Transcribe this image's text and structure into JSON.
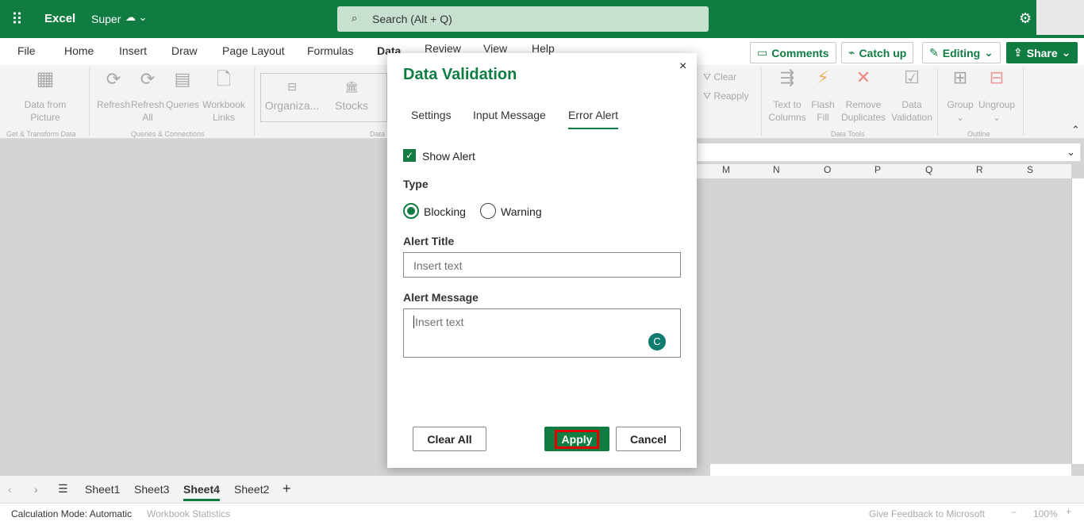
{
  "app": {
    "name": "Excel",
    "file": "Super",
    "search_placeholder": "Search (Alt + Q)"
  },
  "menu": [
    "File",
    "Home",
    "Insert",
    "Draw",
    "Page Layout",
    "Formulas",
    "Data",
    "Review",
    "View",
    "Help"
  ],
  "actions": {
    "comments": "Comments",
    "catchup": "Catch up",
    "editing": "Editing",
    "share": "Share"
  },
  "ribbon": {
    "data_from_picture": "Data from Picture",
    "get_transform": "Get & Transform Data",
    "refresh": "Refresh",
    "refresh_all": "Refresh All",
    "queries": "Queries",
    "workbook_links": "Workbook Links",
    "queries_connections": "Queries & Connections",
    "organiza": "Organiza...",
    "stocks": "Stocks",
    "data_types": "Data",
    "clear": "Clear",
    "reapply": "Reapply",
    "text_to_columns": "Text to Columns",
    "flash_fill": "Flash Fill",
    "remove_duplicates": "Remove Duplicates",
    "data_validation": "Data Validation",
    "data_tools": "Data Tools",
    "group": "Group",
    "ungroup": "Ungroup",
    "outline": "Outline"
  },
  "columns": [
    "M",
    "N",
    "O",
    "P",
    "Q",
    "R",
    "S"
  ],
  "dialog": {
    "title": "Data Validation",
    "tabs": [
      "Settings",
      "Input Message",
      "Error Alert"
    ],
    "active_tab": "Error Alert",
    "show_alert": "Show Alert",
    "show_alert_checked": true,
    "type_label": "Type",
    "type_options": [
      "Blocking",
      "Warning"
    ],
    "type_selected": "Blocking",
    "alert_title_label": "Alert Title",
    "alert_title_placeholder": "Insert text",
    "alert_message_label": "Alert Message",
    "alert_message_placeholder": "Insert text",
    "clear_all": "Clear All",
    "apply": "Apply",
    "cancel": "Cancel"
  },
  "sheets": [
    "Sheet1",
    "Sheet3",
    "Sheet4",
    "Sheet2"
  ],
  "active_sheet": "Sheet4",
  "status": {
    "calc_mode": "Calculation Mode: Automatic",
    "workbook_stats": "Workbook Statistics",
    "feedback": "Give Feedback to Microsoft",
    "zoom": "100%"
  },
  "colors": {
    "brand": "#107c41",
    "highlight": "#e00000"
  }
}
